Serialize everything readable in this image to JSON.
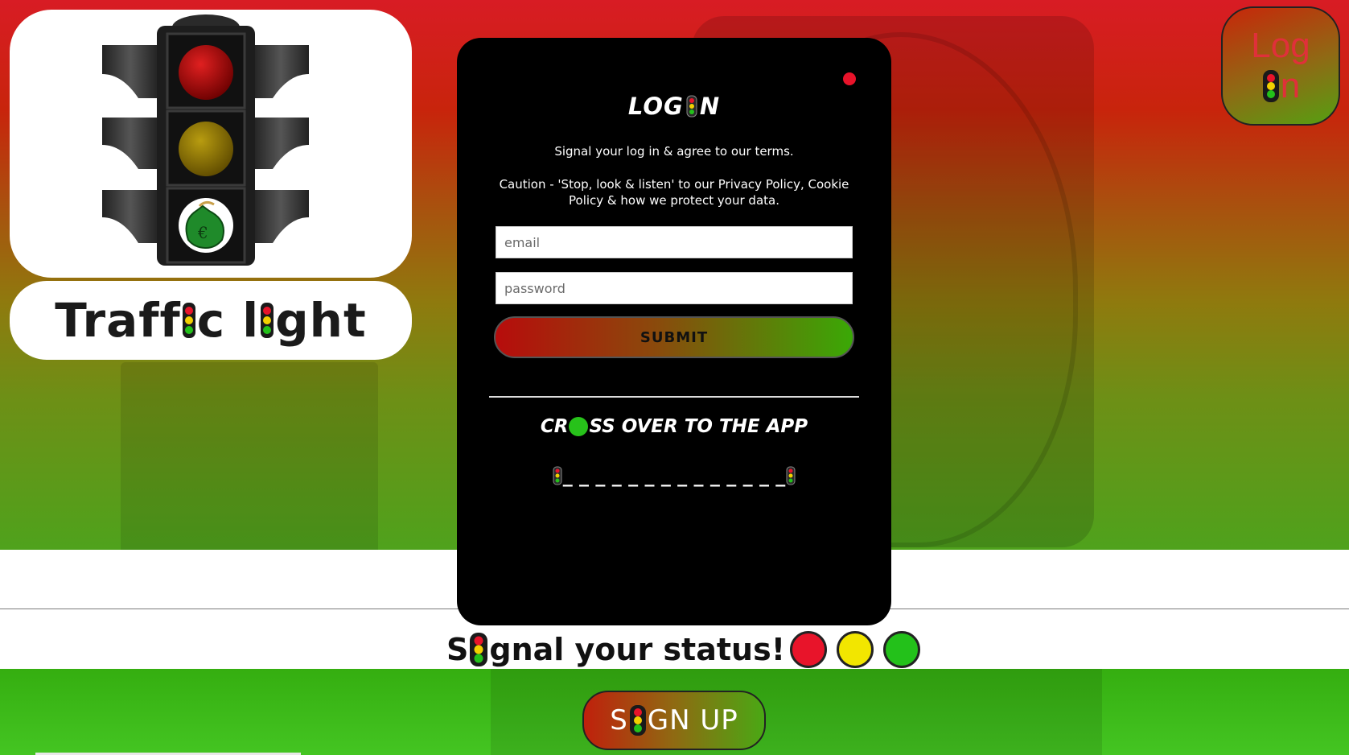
{
  "brand": {
    "name_part1": "Traff",
    "name_part2": "c l",
    "name_part3": "ght"
  },
  "corner_login": {
    "line1": "Log",
    "line2_suffix": "n"
  },
  "modal": {
    "title_before": "LOG ",
    "title_after": "N",
    "subtitle": "Signal your log in & agree to our terms.",
    "caution": "Caution - 'Stop, look & listen' to our Privacy Policy, Cookie Policy & how we protect your data.",
    "email_placeholder": "email",
    "password_placeholder": "password",
    "submit_label": "SUBMIT",
    "cross_before": "CR",
    "cross_after": "SS OVER TO THE APP",
    "dashes": "_ _ _ _ _ _ _ _ _ _ _ _ _ _"
  },
  "status": {
    "text_before": "S",
    "text_after": "gnal your status!"
  },
  "signup": {
    "before": "S",
    "after": "GN UP"
  },
  "colors": {
    "red": "#e8142a",
    "yellow": "#f2e600",
    "green": "#23c11a"
  }
}
